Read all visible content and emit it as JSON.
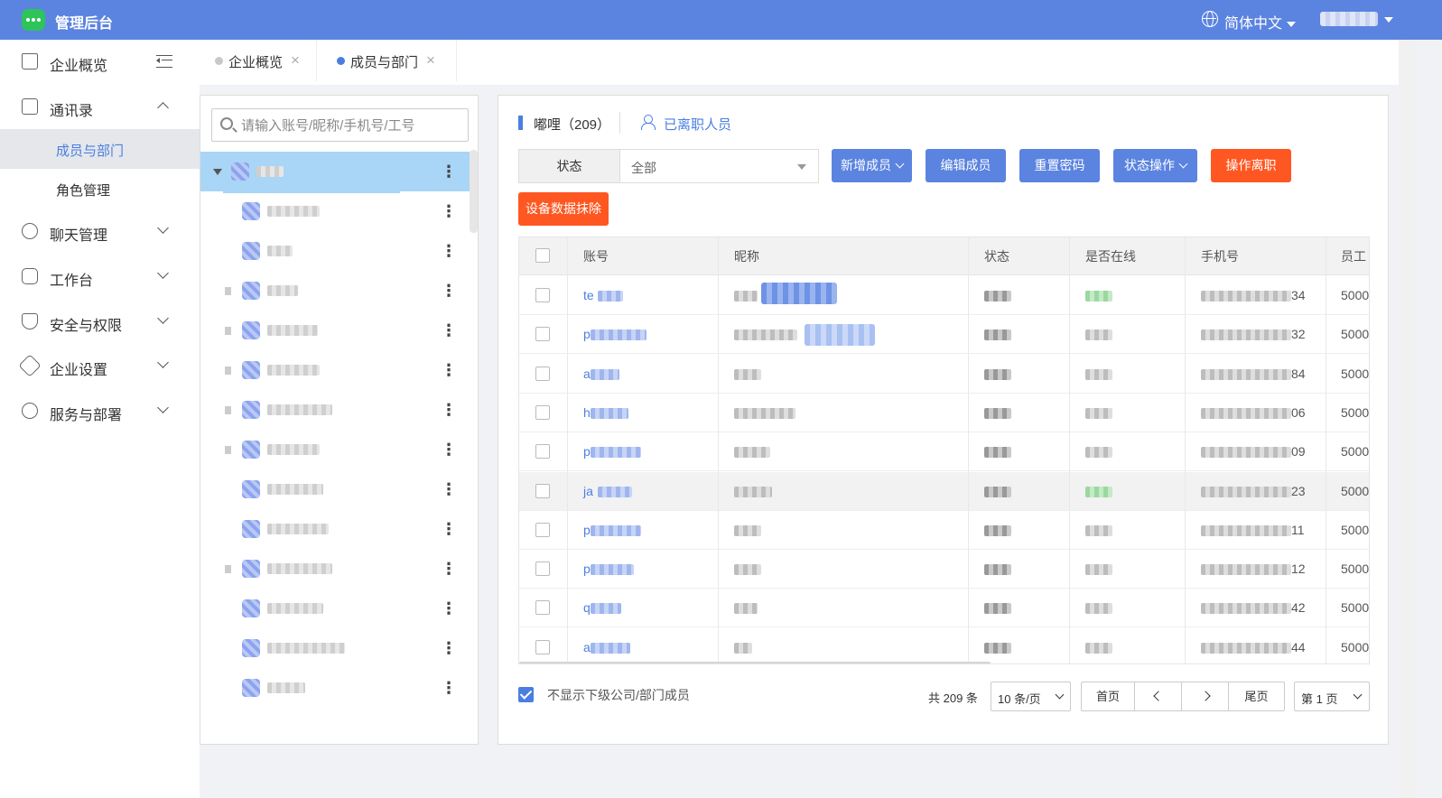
{
  "header": {
    "app_title": "管理后台",
    "language": "简体中文"
  },
  "sidebar": {
    "items": [
      {
        "label": "企业概览",
        "icon": "home-icon"
      },
      {
        "label": "通讯录",
        "icon": "contacts-icon",
        "expanded": true,
        "children": [
          {
            "label": "成员与部门",
            "active": true
          },
          {
            "label": "角色管理",
            "active": false
          }
        ]
      },
      {
        "label": "聊天管理",
        "icon": "chat-icon"
      },
      {
        "label": "工作台",
        "icon": "workbench-icon"
      },
      {
        "label": "安全与权限",
        "icon": "shield-icon"
      },
      {
        "label": "企业设置",
        "icon": "settings-icon"
      },
      {
        "label": "服务与部署",
        "icon": "service-icon"
      }
    ]
  },
  "tabs": [
    {
      "label": "企业概览",
      "active": false
    },
    {
      "label": "成员与部门",
      "active": true
    }
  ],
  "tree": {
    "search_placeholder": "请输入账号/昵称/手机号/工号"
  },
  "main": {
    "dept_name": "嘟哩（209）",
    "left_staff_link": "已离职人员",
    "status_label": "状态",
    "status_value": "全部",
    "buttons": {
      "add_member": "新增成员",
      "edit_member": "编辑成员",
      "reset_password": "重置密码",
      "status_ops": "状态操作",
      "resign": "操作离职",
      "wipe_device": "设备数据抹除"
    }
  },
  "table": {
    "columns": [
      "账号",
      "昵称",
      "状态",
      "是否在线",
      "手机号",
      "员工"
    ],
    "rows": [
      {
        "account": "te",
        "phone_tail": "34",
        "emp": "5000"
      },
      {
        "account": "p",
        "phone_tail": "32",
        "emp": "5000"
      },
      {
        "account": "a",
        "phone_tail": "84",
        "emp": "5000"
      },
      {
        "account": "h",
        "phone_tail": "06",
        "emp": "5000"
      },
      {
        "account": "p",
        "phone_tail": "09",
        "emp": "5000"
      },
      {
        "account": "ja",
        "phone_tail": "23",
        "emp": "5000"
      },
      {
        "account": "p",
        "phone_tail": "11",
        "emp": "5000"
      },
      {
        "account": "p",
        "phone_tail": "12",
        "emp": "5000"
      },
      {
        "account": "q",
        "phone_tail": "42",
        "emp": "5000"
      },
      {
        "account": "a",
        "phone_tail": "44",
        "emp": "5000"
      }
    ]
  },
  "footer": {
    "hide_sub_label": "不显示下级公司/部门成员",
    "total": "共 209 条",
    "page_size": "10 条/页",
    "first": "首页",
    "last": "尾页",
    "page_jump": "第 1 页"
  },
  "colors": {
    "header_bg": "#5b83e0",
    "accent": "#4a7fe0",
    "danger": "#ff5722",
    "logo_green": "#2dc45a"
  }
}
